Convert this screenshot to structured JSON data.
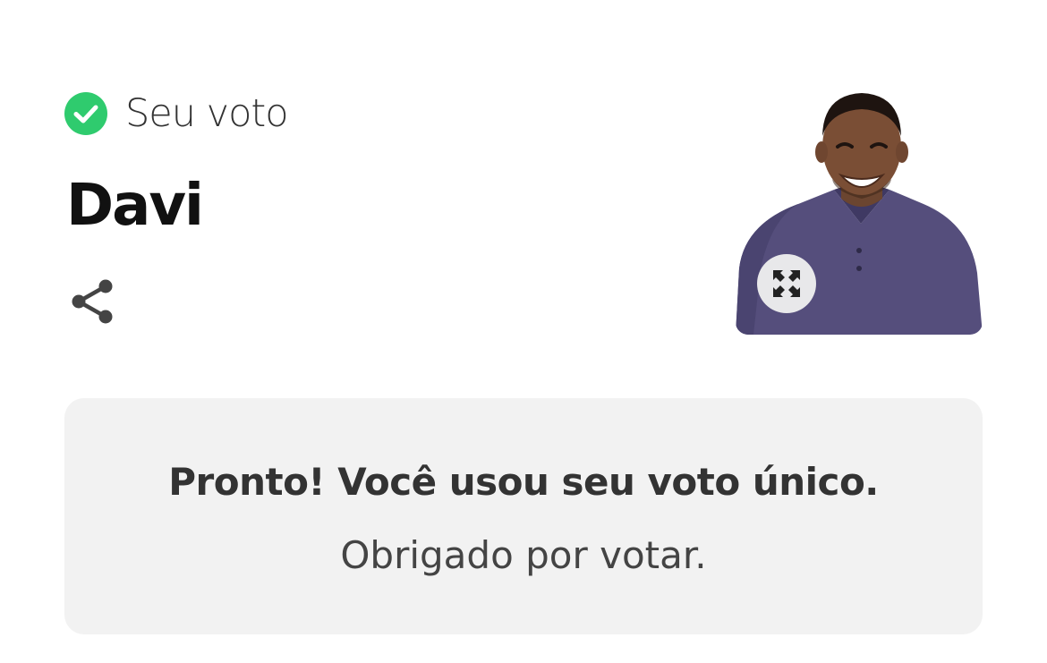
{
  "vote": {
    "label": "Seu voto",
    "status_icon": "check-circle-icon",
    "status_color": "#2fcb6e"
  },
  "candidate": {
    "name": "Davi",
    "photo_alt": "Davi",
    "share_icon": "share-icon",
    "expand_icon": "expand-icon"
  },
  "confirmation": {
    "title": "Pronto! Você usou seu voto único.",
    "subtitle": "Obrigado por votar."
  }
}
